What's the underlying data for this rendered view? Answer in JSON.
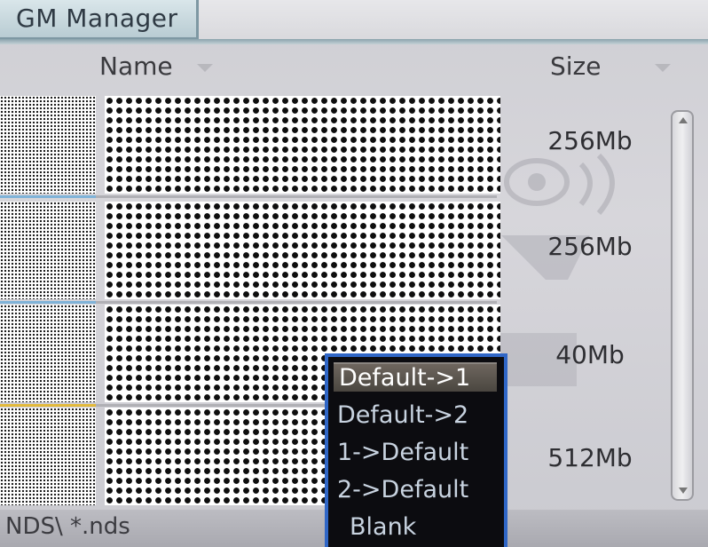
{
  "tab": {
    "label": "GM Manager"
  },
  "header": {
    "name_label": "Name",
    "size_label": "Size"
  },
  "rows": [
    {
      "size": "256Mb"
    },
    {
      "size": "256Mb"
    },
    {
      "size": "40Mb"
    },
    {
      "size": "512Mb"
    }
  ],
  "footer": {
    "path": "NDS\\ *.nds"
  },
  "context_menu": {
    "items": [
      "Default->1",
      "Default->2",
      "1->Default",
      "2->Default",
      "Blank"
    ],
    "selected_index": 0
  },
  "colors": {
    "menu_border": "#2f66c6",
    "menu_background": "#0c0c10",
    "tab_background": "#c8d8de",
    "row_accent_blue": "#7fb3d8",
    "row_accent_yellow": "#e2b93a"
  }
}
